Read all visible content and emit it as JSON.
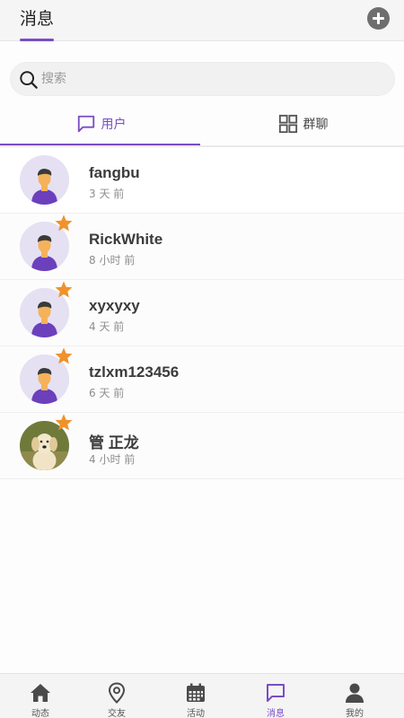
{
  "header": {
    "title": "消息",
    "add_icon": "plus-circle-icon"
  },
  "search": {
    "placeholder": "搜索",
    "icon": "search-icon"
  },
  "tabs": [
    {
      "label": "用户",
      "icon": "chat-bubble-icon",
      "active": true
    },
    {
      "label": "群聊",
      "icon": "grid-icon",
      "active": false
    }
  ],
  "conversations": [
    {
      "name": "fangbu",
      "time": "3 天 前",
      "avatar": "default-avatar",
      "starred": false
    },
    {
      "name": "RickWhite",
      "time": "8 小时 前",
      "avatar": "default-avatar",
      "starred": true
    },
    {
      "name": "xyxyxy",
      "time": "4 天 前",
      "avatar": "default-avatar",
      "starred": true
    },
    {
      "name": "tzlxm123456",
      "time": "6 天 前",
      "avatar": "default-avatar",
      "starred": true
    },
    {
      "name": "管 正龙",
      "time": "4 小时 前",
      "avatar": "dog-photo-avatar",
      "starred": true
    }
  ],
  "bottom_nav": [
    {
      "label": "动态",
      "icon": "home-icon",
      "active": false
    },
    {
      "label": "交友",
      "icon": "location-pin-icon",
      "active": false
    },
    {
      "label": "活动",
      "icon": "calendar-icon",
      "active": false
    },
    {
      "label": "消息",
      "icon": "chat-bubble-icon",
      "active": true
    },
    {
      "label": "我的",
      "icon": "person-icon",
      "active": false
    }
  ],
  "colors": {
    "accent": "#7a4dc4",
    "star": "#f0922b",
    "avatar_bg": "#e5e1f2"
  }
}
